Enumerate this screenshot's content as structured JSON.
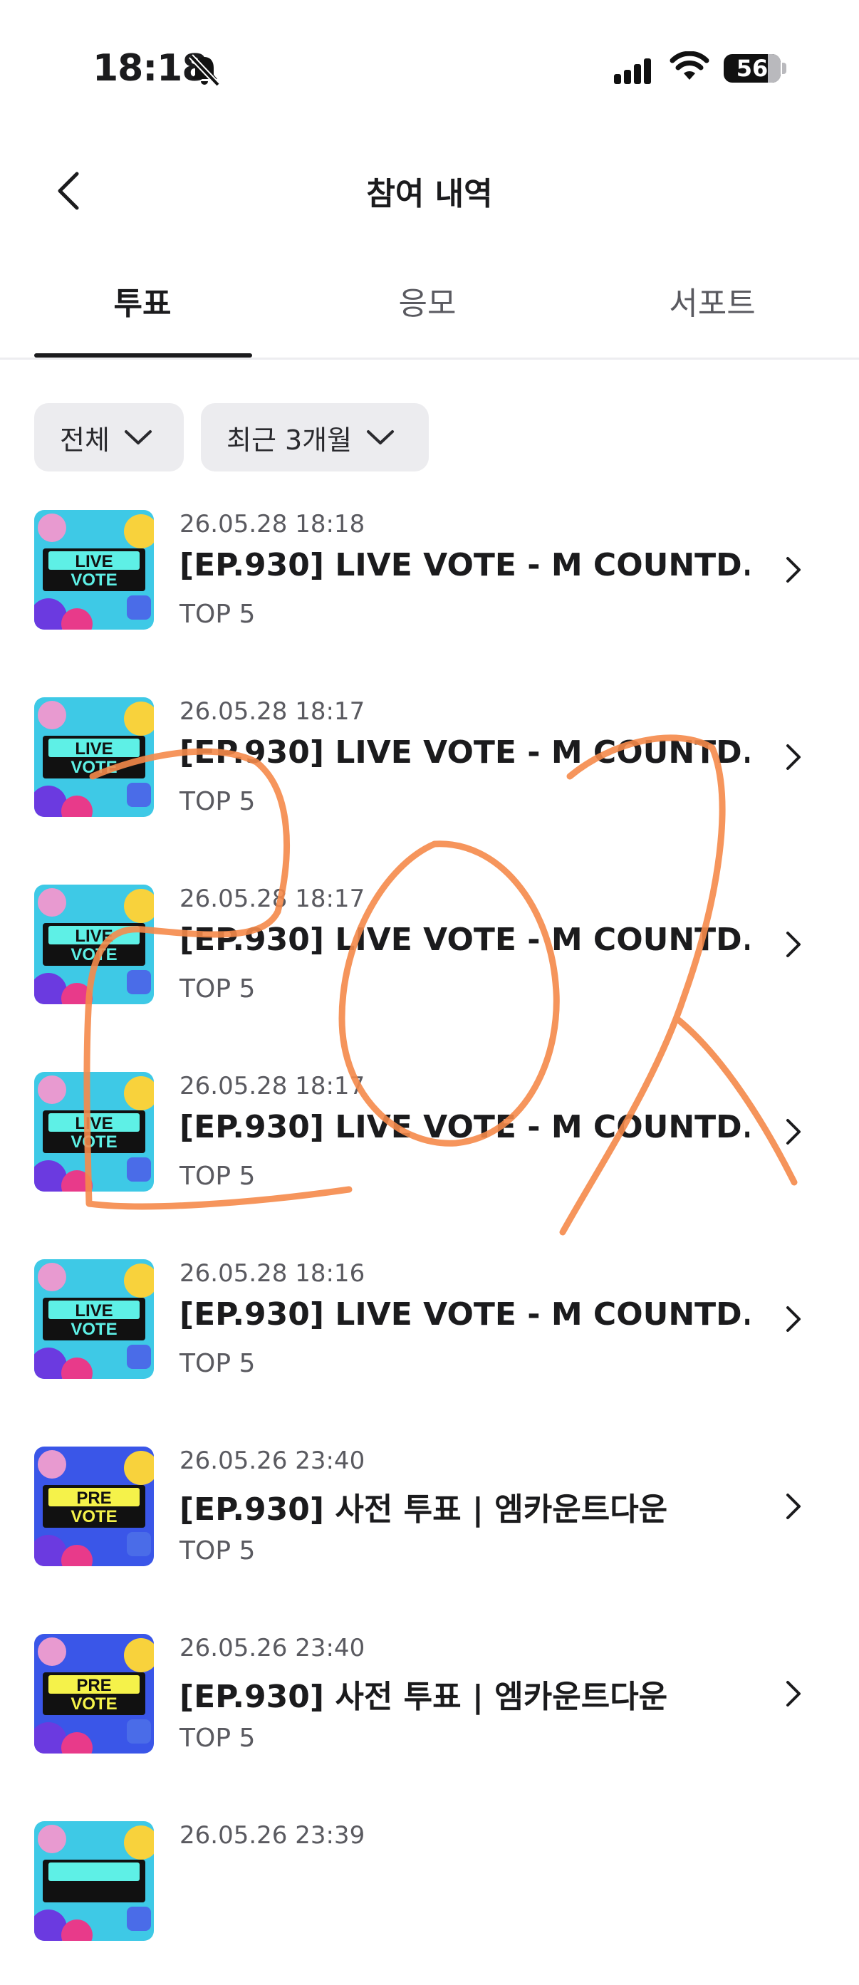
{
  "status_bar": {
    "time": "18:18",
    "battery": "56"
  },
  "header": {
    "title": "참여 내역"
  },
  "tabs": [
    {
      "label": "투표",
      "active": true
    },
    {
      "label": "응모",
      "active": false
    },
    {
      "label": "서포트",
      "active": false
    }
  ],
  "filters": {
    "type": "전체",
    "period": "최근 3개월"
  },
  "items": [
    {
      "badge_top": "LIVE",
      "badge_bottom": "VOTE",
      "date": "26.05.28 18:18",
      "title": "[EP.930] LIVE VOTE - M COUNTD...",
      "sub": "TOP 5"
    },
    {
      "badge_top": "LIVE",
      "badge_bottom": "VOTE",
      "date": "26.05.28 18:17",
      "title": "[EP.930] LIVE VOTE - M COUNTD...",
      "sub": "TOP 5"
    },
    {
      "badge_top": "LIVE",
      "badge_bottom": "VOTE",
      "date": "26.05.28 18:17",
      "title": "[EP.930] LIVE VOTE - M COUNTD...",
      "sub": "TOP 5"
    },
    {
      "badge_top": "LIVE",
      "badge_bottom": "VOTE",
      "date": "26.05.28 18:17",
      "title": "[EP.930] LIVE VOTE - M COUNTD...",
      "sub": "TOP 5"
    },
    {
      "badge_top": "LIVE",
      "badge_bottom": "VOTE",
      "date": "26.05.28 18:16",
      "title": "[EP.930] LIVE VOTE - M COUNTD...",
      "sub": "TOP 5"
    },
    {
      "badge_top": "PRE",
      "badge_bottom": "VOTE",
      "date": "26.05.26 23:40",
      "title": "[EP.930] 사전 투표 | 엠카운트다운",
      "sub": "TOP 5"
    },
    {
      "badge_top": "PRE",
      "badge_bottom": "VOTE",
      "date": "26.05.26 23:40",
      "title": "[EP.930] 사전 투표 | 엠카운트다운",
      "sub": "TOP 5"
    },
    {
      "date": "26.05.26 23:39"
    }
  ],
  "colors": {
    "scribble": "#f5894a",
    "live_bg": "#3ec9e6",
    "pre_bg": "#3a56e8"
  }
}
